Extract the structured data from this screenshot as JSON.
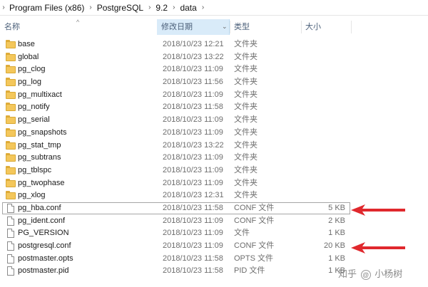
{
  "breadcrumb": [
    "Program Files (x86)",
    "PostgreSQL",
    "9.2",
    "data"
  ],
  "columns": {
    "name": "名称",
    "date": "修改日期",
    "type": "类型",
    "size": "大小"
  },
  "rows": [
    {
      "name": "base",
      "date": "2018/10/23 12:21",
      "type": "文件夹",
      "size": "",
      "kind": "folder"
    },
    {
      "name": "global",
      "date": "2018/10/23 13:22",
      "type": "文件夹",
      "size": "",
      "kind": "folder"
    },
    {
      "name": "pg_clog",
      "date": "2018/10/23 11:09",
      "type": "文件夹",
      "size": "",
      "kind": "folder"
    },
    {
      "name": "pg_log",
      "date": "2018/10/23 11:56",
      "type": "文件夹",
      "size": "",
      "kind": "folder"
    },
    {
      "name": "pg_multixact",
      "date": "2018/10/23 11:09",
      "type": "文件夹",
      "size": "",
      "kind": "folder"
    },
    {
      "name": "pg_notify",
      "date": "2018/10/23 11:58",
      "type": "文件夹",
      "size": "",
      "kind": "folder"
    },
    {
      "name": "pg_serial",
      "date": "2018/10/23 11:09",
      "type": "文件夹",
      "size": "",
      "kind": "folder"
    },
    {
      "name": "pg_snapshots",
      "date": "2018/10/23 11:09",
      "type": "文件夹",
      "size": "",
      "kind": "folder"
    },
    {
      "name": "pg_stat_tmp",
      "date": "2018/10/23 13:22",
      "type": "文件夹",
      "size": "",
      "kind": "folder"
    },
    {
      "name": "pg_subtrans",
      "date": "2018/10/23 11:09",
      "type": "文件夹",
      "size": "",
      "kind": "folder"
    },
    {
      "name": "pg_tblspc",
      "date": "2018/10/23 11:09",
      "type": "文件夹",
      "size": "",
      "kind": "folder"
    },
    {
      "name": "pg_twophase",
      "date": "2018/10/23 11:09",
      "type": "文件夹",
      "size": "",
      "kind": "folder"
    },
    {
      "name": "pg_xlog",
      "date": "2018/10/23 12:31",
      "type": "文件夹",
      "size": "",
      "kind": "folder"
    },
    {
      "name": "pg_hba.conf",
      "date": "2018/10/23 11:58",
      "type": "CONF 文件",
      "size": "5 KB",
      "kind": "file",
      "selected": true
    },
    {
      "name": "pg_ident.conf",
      "date": "2018/10/23 11:09",
      "type": "CONF 文件",
      "size": "2 KB",
      "kind": "file"
    },
    {
      "name": "PG_VERSION",
      "date": "2018/10/23 11:09",
      "type": "文件",
      "size": "1 KB",
      "kind": "file"
    },
    {
      "name": "postgresql.conf",
      "date": "2018/10/23 11:09",
      "type": "CONF 文件",
      "size": "20 KB",
      "kind": "file"
    },
    {
      "name": "postmaster.opts",
      "date": "2018/10/23 11:58",
      "type": "OPTS 文件",
      "size": "1 KB",
      "kind": "file"
    },
    {
      "name": "postmaster.pid",
      "date": "2018/10/23 11:58",
      "type": "PID 文件",
      "size": "1 KB",
      "kind": "file"
    }
  ],
  "annotations": {
    "arrow_color": "#e0282d"
  },
  "watermark": {
    "prefix": "知乎",
    "at": "@",
    "author": "小杨树"
  }
}
